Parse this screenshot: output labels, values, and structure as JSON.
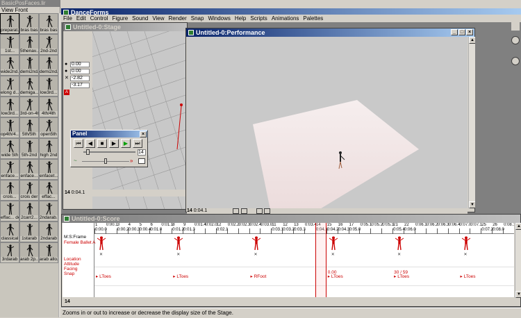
{
  "library": {
    "title": "BasicPosFaces.lir",
    "view_menu": "View",
    "view_mode": "Front",
    "items": [
      "preparat...",
      "bras bas",
      "bras bas",
      "1st...",
      "5thenav...",
      "2nd-2nd",
      "wide2nd...",
      "demi2nd...",
      "demi2nd...",
      "elong d...",
      "demiga...",
      "low3rd...",
      "low3rd...",
      "3rd-on-4th",
      "4th/4th",
      "op4th/4...",
      "5th/5th",
      "open5th",
      "wide 5th",
      "5th-2nd",
      "high 2nd",
      "enface...",
      "enface...",
      "enfacet...",
      "crois...",
      "crois der",
      "effac...",
      "effac... der",
      "2carr2...",
      "2ndarab...",
      "classical",
      "1starab",
      "2ndarab",
      "3rdarab",
      "arab 2p...",
      "arab allo..."
    ],
    "selected_index": 0
  },
  "app": {
    "title": "DanceForms",
    "menu": [
      "File",
      "Edit",
      "Control",
      "Figure",
      "Sound",
      "View",
      "Render",
      "Snap",
      "Windows",
      "Help",
      "Scripts",
      "Animations",
      "Palettes"
    ]
  },
  "stage": {
    "title": "Untitled-0:Stage",
    "coords": [
      {
        "symbol": "●",
        "value": "0.00"
      },
      {
        "symbol": "●",
        "value": "0.00"
      },
      {
        "symbol": "✕",
        "value": "-2.82"
      },
      {
        "symbol": "",
        "value": "-3.17"
      }
    ],
    "frame": "14",
    "time": "0:04.1"
  },
  "panel": {
    "title": "Panel",
    "frame_value": "14",
    "buttons": [
      "⏮",
      "◀",
      "■",
      "▶",
      "▶",
      "⏭"
    ]
  },
  "performance": {
    "title": "Untitled-0:Performance",
    "frame": "14",
    "time": "0:04.1"
  },
  "score": {
    "title": "Untitled-0:Score",
    "header": "M:S:Frame",
    "track_name": "Female Ballet A",
    "rows": [
      "Location",
      "Attitude",
      "Facing",
      "Snap"
    ],
    "ticks": [
      {
        "n": "1",
        "t": "0:00.0"
      },
      {
        "n": "",
        "t": "0:00.1"
      },
      {
        "n": "3",
        "t": "0:00.2"
      },
      {
        "n": "4",
        "t": "0:00.3"
      },
      {
        "n": "5",
        "t": "0:00.4"
      },
      {
        "n": "6",
        "t": "0:01.0"
      },
      {
        "n": "",
        "t": "0:01.1"
      },
      {
        "n": "8",
        "t": "0:01.2"
      },
      {
        "n": "9",
        "t": "0:01.3"
      },
      {
        "n": "",
        "t": "0:01.4"
      },
      {
        "n": "",
        "t": "0:02.0"
      },
      {
        "n": "12",
        "t": "0:02.1"
      },
      {
        "n": "",
        "t": "0:02.2"
      },
      {
        "n": "",
        "t": "0:02.3"
      },
      {
        "n": "",
        "t": "0:02.4"
      },
      {
        "n": "",
        "t": "0:03.0"
      },
      {
        "n": "11",
        "t": "0:03.1"
      },
      {
        "n": "12",
        "t": "0:03.2"
      },
      {
        "n": "13",
        "t": "0:03.3"
      },
      {
        "n": "",
        "t": "0:03.4"
      },
      {
        "n": "14",
        "t": "0:04.1"
      },
      {
        "n": "15",
        "t": "0:04.2"
      },
      {
        "n": "16",
        "t": "0:04.3"
      },
      {
        "n": "17",
        "t": "0:05.0"
      },
      {
        "n": "",
        "t": "0:05.1"
      },
      {
        "n": "",
        "t": "0:05.2"
      },
      {
        "n": "",
        "t": "0:05.3"
      },
      {
        "n": "21",
        "t": "0:05.4"
      },
      {
        "n": "22",
        "t": "0:06.0"
      },
      {
        "n": "",
        "t": "0:06.1"
      },
      {
        "n": "",
        "t": "0:06.2"
      },
      {
        "n": "",
        "t": "0:06.3"
      },
      {
        "n": "",
        "t": "0:06.4"
      },
      {
        "n": "",
        "t": "0:07.0"
      },
      {
        "n": "",
        "t": "0:07.1"
      },
      {
        "n": "25",
        "t": "0:07.2"
      },
      {
        "n": "26",
        "t": "0:08.0"
      },
      {
        "n": "",
        "t": "0:08.1"
      }
    ],
    "snap_labels": [
      {
        "text": "LToes",
        "col": 0
      },
      {
        "text": "LToes",
        "col": 7
      },
      {
        "text": "RFoot",
        "col": 14
      },
      {
        "text": "LToes",
        "col": 21
      },
      {
        "text": "LToes",
        "col": 27
      },
      {
        "text": "LToes",
        "col": 33
      }
    ],
    "facing_values": [
      {
        "text": "0.00",
        "col": 21
      },
      {
        "text": "30 / 59",
        "col": 27
      }
    ],
    "frame": "14"
  },
  "status": "Zooms in or out to increase or decrease the display size of the Stage."
}
